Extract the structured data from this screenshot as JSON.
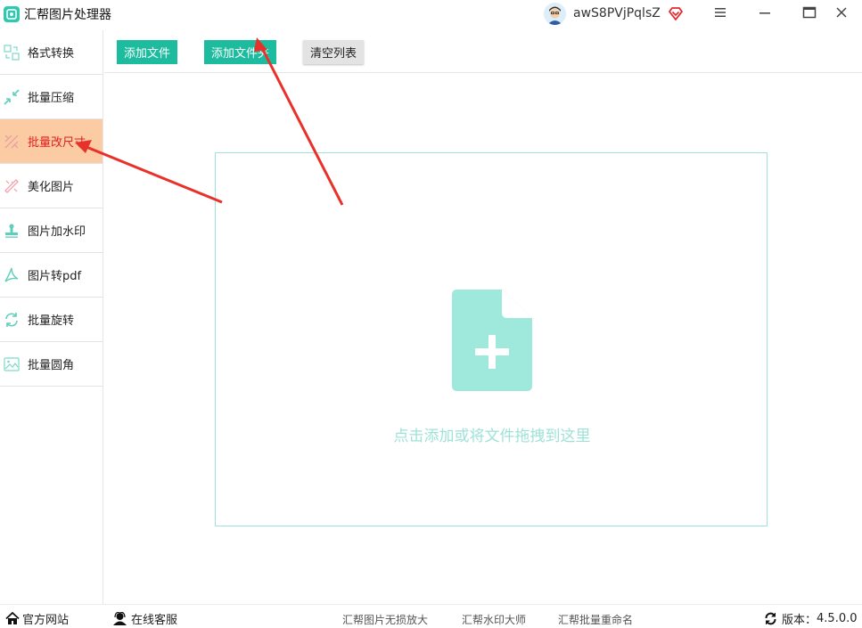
{
  "app": {
    "title": "汇帮图片处理器"
  },
  "user": {
    "name": "awS8PVjPqlsZ"
  },
  "window_controls": {
    "menu": "menu-icon",
    "minimize": "minimize-icon",
    "maximize": "maximize-icon",
    "close": "close-icon"
  },
  "sidebar": {
    "items": [
      {
        "label": "格式转换",
        "icon": "convert-icon"
      },
      {
        "label": "批量压缩",
        "icon": "compress-icon"
      },
      {
        "label": "批量改尺寸",
        "icon": "resize-icon",
        "active": true
      },
      {
        "label": "美化图片",
        "icon": "beautify-icon"
      },
      {
        "label": "图片加水印",
        "icon": "watermark-icon"
      },
      {
        "label": "图片转pdf",
        "icon": "pdf-icon"
      },
      {
        "label": "批量旋转",
        "icon": "rotate-icon"
      },
      {
        "label": "批量圆角",
        "icon": "rounded-corner-icon"
      }
    ]
  },
  "toolbar": {
    "add_file": "添加文件",
    "add_folder": "添加文件夹",
    "clear_list": "清空列表"
  },
  "dropzone": {
    "hint": "点击添加或将文件拖拽到这里"
  },
  "footer": {
    "website": "官方网站",
    "support": "在线客服",
    "links": [
      "汇帮图片无损放大",
      "汇帮水印大师",
      "汇帮批量重命名"
    ],
    "version_label": "版本：",
    "version": "4.5.0.0"
  },
  "colors": {
    "accent": "#1ebc9e",
    "active_bg": "#fbcba4",
    "active_text": "#e0201d",
    "arrow": "#e8312a",
    "dropzone_border": "#9ee3da"
  }
}
